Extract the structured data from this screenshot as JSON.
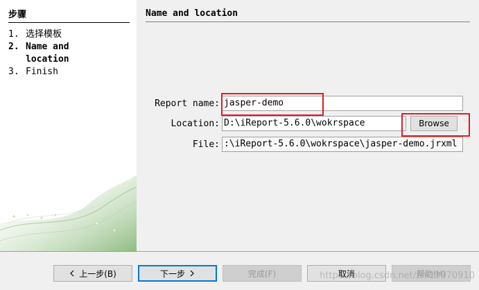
{
  "steps": {
    "title": "步骤",
    "items": [
      {
        "num": "1.",
        "label": "选择模板",
        "active": false
      },
      {
        "num": "2.",
        "label": "Name and location",
        "active": true
      },
      {
        "num": "3.",
        "label": "Finish",
        "active": false
      }
    ]
  },
  "panel": {
    "title": "Name and location"
  },
  "form": {
    "report_name_label": "Report name:",
    "report_name_value": "jasper-demo",
    "location_label": "Location:",
    "location_value": "D:\\iReport-5.6.0\\wokrspace",
    "browse_label": "Browse",
    "file_label": "File:",
    "file_value": ":\\iReport-5.6.0\\wokrspace\\jasper-demo.jrxml"
  },
  "footer": {
    "back_label": "上一步(B)",
    "back_icon": "chevron-left-icon",
    "next_label": "下一步",
    "next_icon": "chevron-right-icon",
    "finish_label": "完成(F)",
    "cancel_label": "取消",
    "help_label": "帮助(H)"
  },
  "watermark": "https://blog.csdn.net/zhi19970910",
  "colors": {
    "highlight": "#e01a22",
    "focus_border": "#0078d7",
    "decor_green": "#6aa35a"
  }
}
